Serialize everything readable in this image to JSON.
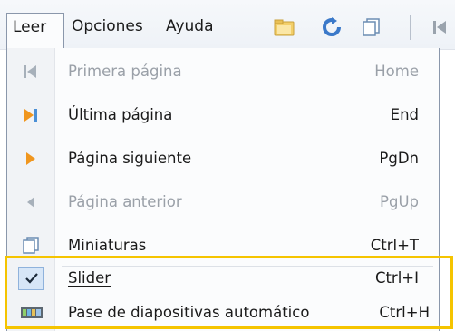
{
  "menubar": {
    "menus": [
      {
        "label": "Leer"
      },
      {
        "label": "Opciones"
      },
      {
        "label": "Ayuda"
      }
    ],
    "toolbar_icons": [
      "open-folder-icon",
      "refresh-icon",
      "copy-pages-icon",
      "first-page-icon"
    ]
  },
  "dropdown": {
    "items": [
      {
        "label": "Primera página",
        "shortcut": "Home",
        "icon": "first-page-icon",
        "enabled": false
      },
      {
        "label": "Última página",
        "shortcut": "End",
        "icon": "last-page-icon",
        "enabled": true
      },
      {
        "label": "Página siguiente",
        "shortcut": "PgDn",
        "icon": "next-page-icon",
        "enabled": true
      },
      {
        "label": "Página anterior",
        "shortcut": "PgUp",
        "icon": "previous-page-icon",
        "enabled": false
      },
      {
        "label": "Miniaturas",
        "shortcut": "Ctrl+T",
        "icon": "thumbnails-icon",
        "enabled": true
      },
      {
        "label": "Slider",
        "shortcut": "Ctrl+I",
        "icon": "checkmark-icon",
        "enabled": true,
        "checked": true
      },
      {
        "label": "Pase de diapositivas automático",
        "shortcut": "Ctrl+H",
        "icon": "slideshow-icon",
        "enabled": true
      }
    ]
  },
  "colors": {
    "accent_highlight": "#f5c400",
    "play_orange": "#f0961e",
    "icon_gray": "#8f98a3",
    "disabled_text": "#9aa0a8"
  }
}
